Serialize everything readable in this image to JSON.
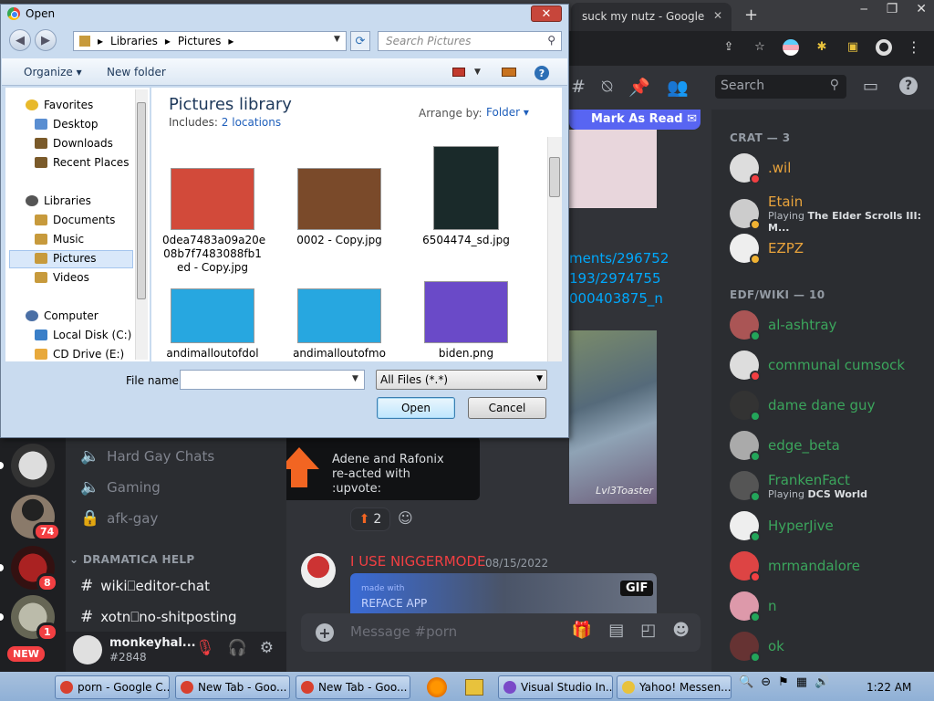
{
  "chrome": {
    "tab2_title": "suck my nutz - Google",
    "newtab": "+",
    "win_controls": [
      "‒",
      "❐",
      "✕"
    ]
  },
  "discord": {
    "search_placeholder": "Search",
    "mark_as_read": "Mark As Read",
    "links": [
      "ments/296752",
      "193/2974755",
      "000403875_n"
    ],
    "game_caption": "Lvl3Toaster",
    "tooltip": "Adene and Rafonix re-acted with :upvote:",
    "reaction_count": "2",
    "message": {
      "user": "I USE NIGGERMODE",
      "date": "08/15/2022",
      "gif_badge": "GIF",
      "made_with": "made with",
      "reface": "REFACE APP"
    },
    "input_placeholder": "Message #porn",
    "channels": [
      {
        "name": "Hard Gay Chats",
        "icon": "🔈"
      },
      {
        "name": "Gaming",
        "icon": "🔈"
      },
      {
        "name": "afk-gay",
        "icon": "🔒"
      }
    ],
    "category": "DRAMATICA HELP",
    "text_channels": [
      "wiki⎕editor-chat",
      "xotn⎕no-shitposting"
    ],
    "user": {
      "name": "monkeyhal...",
      "tag": "#2848"
    },
    "server_badges": [
      "74",
      "8",
      "1"
    ],
    "new_badge": "NEW",
    "member_sections": [
      {
        "title": "CRAT — 3"
      },
      {
        "title": "EDF/WIKI — 10"
      }
    ],
    "members": [
      {
        "name": ".wil",
        "color": "#e8a33c",
        "status": "dnd",
        "activity_prefix": "",
        "activity": ""
      },
      {
        "name": "Etain",
        "color": "#e8a33c",
        "status": "idle",
        "activity_prefix": "Playing ",
        "activity": "The Elder Scrolls III: M..."
      },
      {
        "name": "EZPZ",
        "color": "#e8a33c",
        "status": "idle",
        "activity_prefix": "",
        "activity": ""
      },
      {
        "name": "al-ashtray",
        "color": "#3ba55c",
        "status": "online",
        "activity_prefix": "",
        "activity": ""
      },
      {
        "name": "communal cumsock",
        "color": "#3ba55c",
        "status": "dnd",
        "activity_prefix": "",
        "activity": ""
      },
      {
        "name": "dame dane guy",
        "color": "#3ba55c",
        "status": "online",
        "activity_prefix": "",
        "activity": ""
      },
      {
        "name": "edge_beta",
        "color": "#3ba55c",
        "status": "online",
        "activity_prefix": "",
        "activity": ""
      },
      {
        "name": "FrankenFact",
        "color": "#3ba55c",
        "status": "online",
        "activity_prefix": "Playing ",
        "activity": "DCS World"
      },
      {
        "name": "HyperJive",
        "color": "#3ba55c",
        "status": "online",
        "activity_prefix": "",
        "activity": ""
      },
      {
        "name": "mrmandalore",
        "color": "#3ba55c",
        "status": "dnd",
        "activity_prefix": "",
        "activity": ""
      },
      {
        "name": "n",
        "color": "#3ba55c",
        "status": "online",
        "activity_prefix": "",
        "activity": ""
      },
      {
        "name": "ok",
        "color": "#3ba55c",
        "status": "online",
        "activity_prefix": "",
        "activity": ""
      }
    ]
  },
  "dialog": {
    "title": "Open",
    "close": "✕",
    "breadcrumb": [
      "Libraries",
      "Pictures"
    ],
    "search_placeholder": "Search Pictures",
    "organize": "Organize ▾",
    "new_folder": "New folder",
    "help": "?",
    "nav": [
      {
        "label": "Favorites",
        "icon_color": "#e8b92b"
      },
      {
        "label": "Desktop",
        "icon_color": "#5a8ed1"
      },
      {
        "label": "Downloads",
        "icon_color": "#7a5a2a"
      },
      {
        "label": "Recent Places",
        "icon_color": "#7a5a2a"
      },
      {
        "label": "Libraries",
        "icon_color": "#555"
      },
      {
        "label": "Documents",
        "icon_color": "#c79a3c"
      },
      {
        "label": "Music",
        "icon_color": "#c79a3c"
      },
      {
        "label": "Pictures",
        "icon_color": "#c79a3c"
      },
      {
        "label": "Videos",
        "icon_color": "#c79a3c"
      },
      {
        "label": "Computer",
        "icon_color": "#4a6fa5"
      },
      {
        "label": "Local Disk (C:)",
        "icon_color": "#3a7fc8"
      },
      {
        "label": "CD Drive (E:)",
        "icon_color": "#e8a93c"
      }
    ],
    "library_title": "Pictures library",
    "includes_prefix": "Includes: ",
    "includes_link": "2 locations",
    "arrange_by": "Arrange by:",
    "arrange_value": "Folder ▾",
    "files": [
      {
        "name": "0dea7483a09a20e 08b7f7483088fb1 ed - Copy.jpg",
        "color": "#d24a3a"
      },
      {
        "name": "0002 - Copy.jpg",
        "color": "#7a4a2a"
      },
      {
        "name": "6504474_sd.jpg",
        "color": "#1a2a2a"
      },
      {
        "name": "andimalloutofdol",
        "color": "#27a7e0"
      },
      {
        "name": "andimalloutofmo",
        "color": "#27a7e0"
      },
      {
        "name": "biden.png",
        "color": "#6a4ac8"
      }
    ],
    "file_name_label": "File name:",
    "file_name_value": "",
    "file_type": "All Files (*.*)",
    "open": "Open",
    "cancel": "Cancel"
  },
  "taskbar": {
    "items": [
      {
        "label": "porn - Google C...",
        "color": "#d8402e"
      },
      {
        "label": "New Tab - Goo...",
        "color": "#d8402e"
      },
      {
        "label": "New Tab - Goo...",
        "color": "#d8402e"
      },
      {
        "label": "Visual Studio In...",
        "color": "#7a4ac8"
      },
      {
        "label": "Yahoo! Messen...",
        "color": "#e8c23c"
      }
    ],
    "time": "1:22 AM"
  }
}
